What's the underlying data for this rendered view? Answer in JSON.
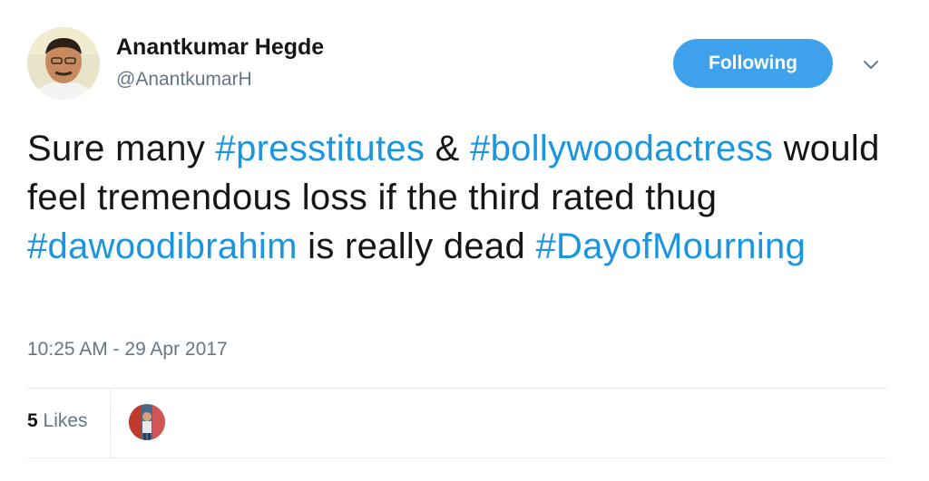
{
  "author": {
    "name": "Anantkumar Hegde",
    "handle": "@AnantkumarH",
    "avatar_icon": "profile-photo"
  },
  "follow_button": {
    "label": "Following",
    "color": "#3ea1ec"
  },
  "menu_icon": "chevron-down-icon",
  "tweet": {
    "segments": [
      {
        "text": "Sure many ",
        "type": "text"
      },
      {
        "text": "#presstitutes",
        "type": "hashtag"
      },
      {
        "text": " & ",
        "type": "text"
      },
      {
        "text": "#bollywoodactress",
        "type": "hashtag"
      },
      {
        "text": " would feel tremendous loss if the third rated thug ",
        "type": "text"
      },
      {
        "text": "#dawoodibrahim",
        "type": "hashtag"
      },
      {
        "text": " is really dead ",
        "type": "text"
      },
      {
        "text": "#DayofMourning",
        "type": "hashtag"
      }
    ],
    "hashtag_color": "#1b95e0"
  },
  "timestamp": "10:25 AM - 29 Apr 2017",
  "engagement": {
    "likes_count": "5",
    "likes_label": " Likes",
    "liker_avatar_icon": "user-avatar"
  }
}
